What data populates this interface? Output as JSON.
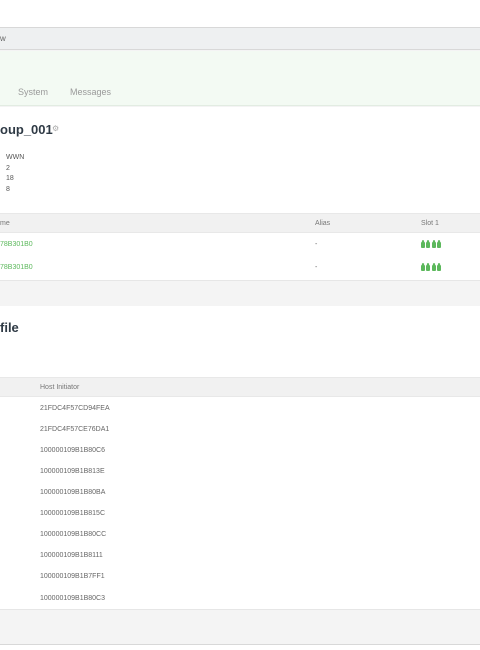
{
  "breadcrumb": {
    "text": "w"
  },
  "tabs": [
    {
      "label": "System"
    },
    {
      "label": "Messages"
    }
  ],
  "group": {
    "title": "oup_001",
    "props": [
      "WWN",
      "2",
      "18",
      "8"
    ],
    "table": {
      "headers": [
        "me",
        "Alias",
        "Slot 1"
      ],
      "rows": [
        {
          "name": "78B301B0",
          "alias": "-"
        },
        {
          "name": "78B301B0",
          "alias": "-"
        }
      ]
    }
  },
  "profile": {
    "title": "file",
    "table": {
      "header": "Host Initiator",
      "rows": [
        "21FDC4F57CD94FEA",
        "21FDC4F57CE76DA1",
        "100000109B1B80C6",
        "100000109B1B813E",
        "100000109B1B80BA",
        "100000109B1B815C",
        "100000109B1B80CC",
        "100000109B1B8111",
        "100000109B1B7FF1",
        "100000109B1B80C3"
      ]
    }
  },
  "colors": {
    "accent": "#5cb85c",
    "title": "#2f3a45"
  },
  "icons": {
    "gear": "gear-icon",
    "slot": "port-status-icon"
  }
}
